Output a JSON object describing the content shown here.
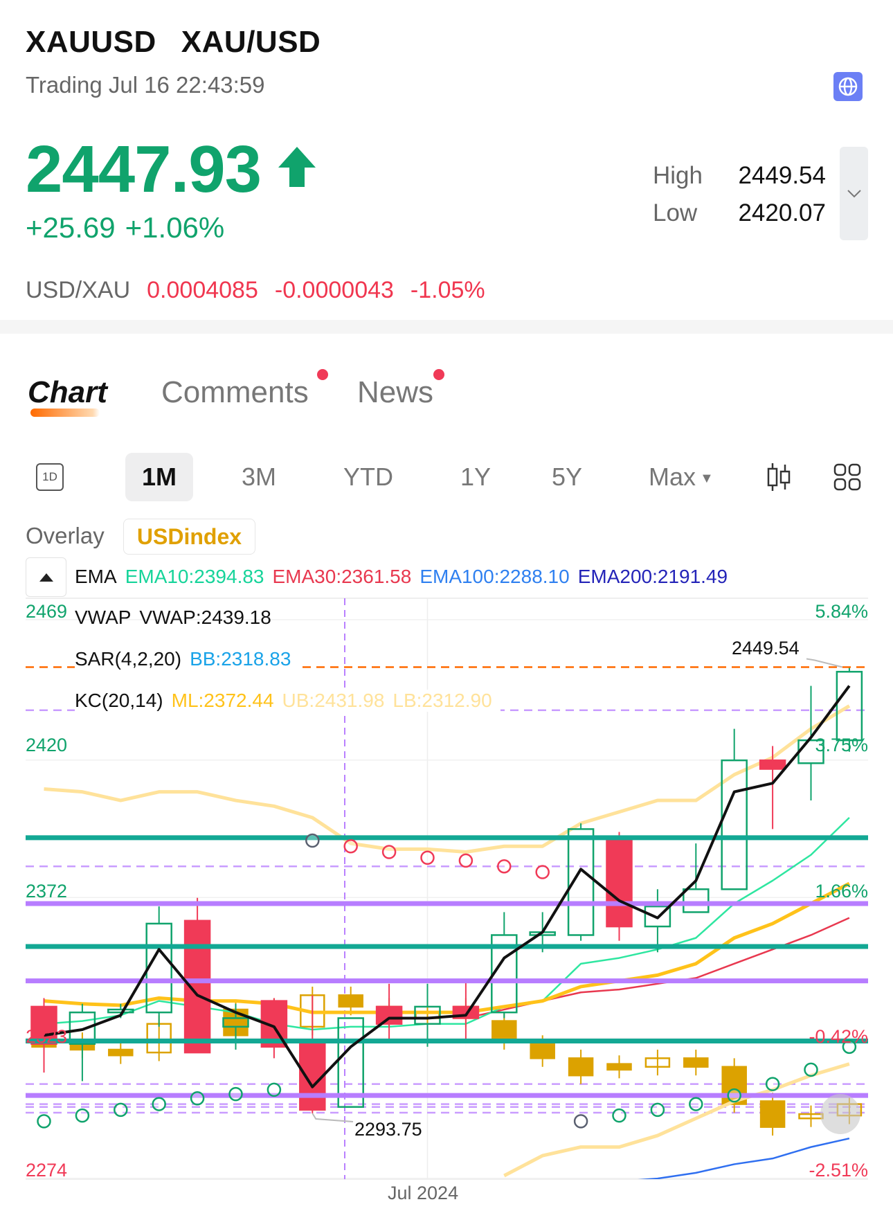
{
  "header": {
    "symbol": "XAUUSD",
    "name": "XAU/USD",
    "status": "Trading Jul 16 22:43:59",
    "globe_icon": "globe-icon"
  },
  "quote": {
    "price": "2447.93",
    "direction_icon": "arrow-up-icon",
    "change": "+25.69",
    "change_pct": "+1.06%",
    "high_label": "High",
    "high": "2449.54",
    "low_label": "Low",
    "low": "2420.07"
  },
  "inverse": {
    "pair": "USD/XAU",
    "price": "0.0004085",
    "change": "-0.0000043",
    "change_pct": "-1.05%"
  },
  "tabs": [
    {
      "label": "Chart",
      "active": true
    },
    {
      "label": "Comments",
      "badge": true
    },
    {
      "label": "News",
      "badge": true
    }
  ],
  "periods": {
    "day_icon": "1D",
    "items": [
      "1M",
      "3M",
      "YTD",
      "1Y",
      "5Y",
      "Max"
    ],
    "selected": "1M",
    "candle_icon": "candlestick-icon",
    "grid_icon": "grid-icon"
  },
  "overlay": {
    "label": "Overlay",
    "value": "USDindex"
  },
  "indicators": {
    "ema": {
      "label": "EMA",
      "ema10": "EMA10:2394.83",
      "ema30": "EMA30:2361.58",
      "ema100": "EMA100:2288.10",
      "ema200": "EMA200:2191.49"
    },
    "vwap": {
      "label": "VWAP",
      "value": "VWAP:2439.18"
    },
    "sar": {
      "label": "SAR(4,2,20)",
      "bb": "BB:2318.83"
    },
    "kc": {
      "label": "KC(20,14)",
      "ml": "ML:2372.44",
      "ub": "UB:2431.98",
      "lb": "LB:2312.90"
    }
  },
  "colors": {
    "up": "#10a36c",
    "down": "#f03a57",
    "overlay": "#dca200",
    "ema10": "#2ee6a0",
    "ema30": "#e8384f",
    "ema100": "#2f6ff0",
    "ema200": "#2424b8",
    "ml": "#ffc21a",
    "band": "#ffe29a",
    "bb": "#1aa3e8",
    "teal_level": "#13a894",
    "purple_level": "#b77dff"
  },
  "chart_data": {
    "type": "candlestick",
    "y_ticks": [
      "2469",
      "2420",
      "2372",
      "2323",
      "2274"
    ],
    "pct_ticks": [
      "5.84%",
      "3.75%",
      "1.66%",
      "-0.42%",
      "-2.51%"
    ],
    "ylim": [
      2274,
      2469
    ],
    "x_label": "Jul 2024",
    "high_marker": "2449.54",
    "low_marker": "2293.75",
    "candles": [
      {
        "o": 2331,
        "h": 2334,
        "l": 2308,
        "c": 2318
      },
      {
        "o": 2318,
        "h": 2332,
        "l": 2305,
        "c": 2329
      },
      {
        "o": 2329,
        "h": 2332,
        "l": 2327,
        "c": 2330
      },
      {
        "o": 2329,
        "h": 2366,
        "l": 2324,
        "c": 2360
      },
      {
        "o": 2361,
        "h": 2369,
        "l": 2315,
        "c": 2315
      },
      {
        "o": 2324,
        "h": 2332,
        "l": 2316,
        "c": 2327
      },
      {
        "o": 2333,
        "h": 2334,
        "l": 2313,
        "c": 2317
      },
      {
        "o": 2318,
        "h": 2335,
        "l": 2293.75,
        "c": 2295
      },
      {
        "o": 2296,
        "h": 2327,
        "l": 2296,
        "c": 2327
      },
      {
        "o": 2331,
        "h": 2339,
        "l": 2319,
        "c": 2325
      },
      {
        "o": 2325,
        "h": 2339,
        "l": 2317,
        "c": 2331
      },
      {
        "o": 2331,
        "h": 2340,
        "l": 2319,
        "c": 2327
      },
      {
        "o": 2329,
        "h": 2364,
        "l": 2327,
        "c": 2356
      },
      {
        "o": 2356,
        "h": 2364,
        "l": 2350,
        "c": 2357
      },
      {
        "o": 2356,
        "h": 2395,
        "l": 2354,
        "c": 2393
      },
      {
        "o": 2389,
        "h": 2392,
        "l": 2354,
        "c": 2359
      },
      {
        "o": 2359,
        "h": 2372,
        "l": 2350,
        "c": 2366
      },
      {
        "o": 2364,
        "h": 2388,
        "l": 2364,
        "c": 2372
      },
      {
        "o": 2372,
        "h": 2428,
        "l": 2372,
        "c": 2417
      },
      {
        "o": 2417,
        "h": 2422,
        "l": 2393,
        "c": 2414
      },
      {
        "o": 2416,
        "h": 2443,
        "l": 2403,
        "c": 2424
      },
      {
        "o": 2424,
        "h": 2449.54,
        "l": 2420,
        "c": 2447.93
      }
    ],
    "overlay_candles": [
      {
        "o": 2322,
        "c": 2317
      },
      {
        "o": 2319,
        "c": 2316
      },
      {
        "o": 2316,
        "c": 2314
      },
      {
        "o": 2315,
        "c": 2325
      },
      {
        "o": 2324,
        "c": 2331
      },
      {
        "o": 2330,
        "c": 2321
      },
      {
        "o": 2321,
        "c": 2331
      },
      {
        "o": 2324,
        "c": 2335
      },
      {
        "o": 2335,
        "c": 2331
      },
      {
        "o": 2331,
        "c": 2327
      },
      {
        "o": 2327,
        "c": 2329
      },
      {
        "o": 2331,
        "c": 2327
      },
      {
        "o": 2326,
        "c": 2319
      },
      {
        "o": 2318,
        "c": 2313
      },
      {
        "o": 2313,
        "c": 2307
      },
      {
        "o": 2311,
        "c": 2309
      },
      {
        "o": 2310,
        "c": 2313
      },
      {
        "o": 2313,
        "c": 2310
      },
      {
        "o": 2310,
        "c": 2297
      },
      {
        "o": 2298,
        "c": 2289
      },
      {
        "o": 2292,
        "c": 2293.5
      },
      {
        "o": 2293,
        "c": 2297
      }
    ],
    "series": {
      "vwap": [
        2321,
        2323,
        2328,
        2351,
        2335,
        2329,
        2324,
        2303,
        2317,
        2327,
        2327,
        2328,
        2348,
        2357,
        2379,
        2368,
        2362,
        2375,
        2406,
        2409,
        2425,
        2443
      ],
      "kc_ub": [
        2407,
        2406,
        2403,
        2406,
        2406,
        2403,
        2401,
        2397,
        2388,
        2386,
        2386,
        2385,
        2387,
        2387,
        2395,
        2399,
        2403,
        2403,
        2412,
        2418,
        2428,
        2436
      ],
      "kc_ml": [
        2333,
        2332,
        2331.5,
        2334,
        2333,
        2333,
        2332,
        2329,
        2329,
        2329,
        2329,
        2329,
        2331,
        2333,
        2338,
        2340,
        2342,
        2346,
        2355,
        2360,
        2367,
        2374
      ],
      "kc_lb": [
        null,
        null,
        null,
        null,
        null,
        null,
        null,
        null,
        null,
        null,
        null,
        null,
        2272,
        2279,
        2282,
        2282,
        2286,
        2292,
        2298,
        2302,
        2307,
        2311
      ],
      "ema10": [
        2325,
        2326,
        2328,
        2333,
        2331,
        2329,
        2325,
        2323,
        2324,
        2324,
        2325,
        2325,
        2331,
        2333,
        2346,
        2348,
        2351,
        2355,
        2367,
        2375,
        2384,
        2397
      ],
      "ema30": [
        null,
        null,
        null,
        null,
        null,
        null,
        null,
        null,
        null,
        null,
        null,
        2327,
        2330,
        2333,
        2336,
        2337,
        2339,
        2341,
        2346,
        2351,
        2356,
        2362
      ],
      "ema100": [
        null,
        null,
        null,
        null,
        null,
        null,
        null,
        null,
        null,
        null,
        null,
        null,
        null,
        null,
        null,
        2270,
        2271,
        2273,
        2276,
        2278,
        2282,
        2285
      ]
    },
    "sar": [
      {
        "v": 2291,
        "s": "up"
      },
      {
        "v": 2293,
        "s": "up"
      },
      {
        "v": 2295,
        "s": "up"
      },
      {
        "v": 2297,
        "s": "up"
      },
      {
        "v": 2299,
        "s": "up"
      },
      {
        "v": 2300.5,
        "s": "up"
      },
      {
        "v": 2302,
        "s": "up"
      },
      {
        "v": 2389,
        "s": "flip"
      },
      {
        "v": 2387,
        "s": "down"
      },
      {
        "v": 2385,
        "s": "down"
      },
      {
        "v": 2383,
        "s": "down"
      },
      {
        "v": 2382,
        "s": "down"
      },
      {
        "v": 2380,
        "s": "down"
      },
      {
        "v": 2378,
        "s": "down"
      },
      {
        "v": 2291,
        "s": "flip"
      },
      {
        "v": 2293,
        "s": "up"
      },
      {
        "v": 2295,
        "s": "up"
      },
      {
        "v": 2297,
        "s": "up"
      },
      {
        "v": 2300,
        "s": "up"
      },
      {
        "v": 2304,
        "s": "up"
      },
      {
        "v": 2309,
        "s": "up"
      },
      {
        "v": 2317,
        "s": "up"
      }
    ],
    "levels": {
      "teal": [
        2390,
        2352,
        2319
      ],
      "purple": [
        2367,
        2340,
        2300
      ],
      "purple_dashed": [
        2434.5,
        2380,
        2304,
        2297,
        2296,
        2294
      ],
      "orange_dashed": [
        2449.54
      ]
    }
  }
}
